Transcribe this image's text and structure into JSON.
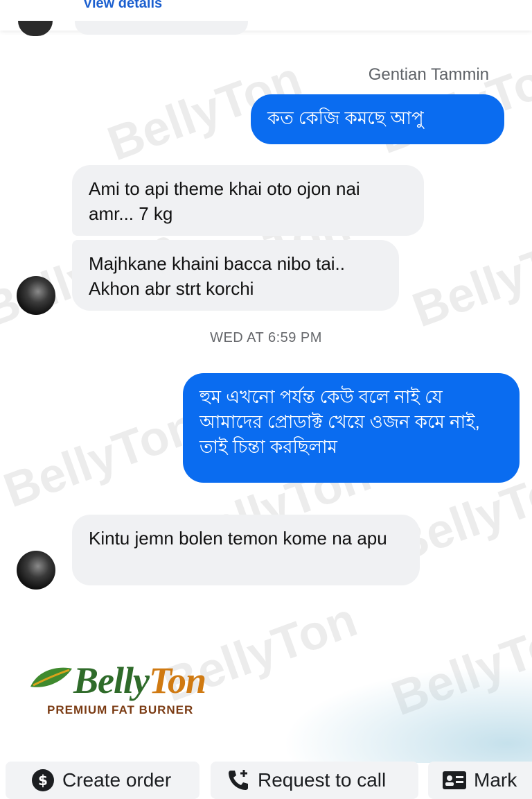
{
  "header": {
    "link_label": "View details"
  },
  "thread": {
    "sender_name": "Gentian Tammin",
    "messages": [
      {
        "id": "m1",
        "direction": "outgoing",
        "text": "কত কেজি কমছে আপু"
      },
      {
        "id": "m2",
        "direction": "incoming",
        "text": "Ami to api theme khai oto ojon nai amr... 7 kg"
      },
      {
        "id": "m3",
        "direction": "incoming",
        "text": "Majhkane khaini bacca nibo tai.. Akhon abr strt korchi"
      },
      {
        "id": "m4",
        "direction": "outgoing",
        "text": "হুম এখনো পর্যন্ত কেউ বলে নাই যে আমাদের প্রোডাক্ট খেয়ে ওজন কমে নাই, তাই চিন্তা করছিলাম"
      },
      {
        "id": "m5",
        "direction": "incoming",
        "text": "Kintu jemn bolen temon kome na apu"
      }
    ],
    "timestamp": "WED AT 6:59 PM"
  },
  "brand": {
    "name_part1": "Belly",
    "name_part2": "Ton",
    "tagline": "PREMIUM FAT BURNER",
    "watermark_text": "BellyTon",
    "colors": {
      "green": "#2f6b2a",
      "orange": "#d07a12",
      "tagline": "#7a3a12"
    }
  },
  "actions": [
    {
      "label": "Create order",
      "icon": "dollar-circle-icon"
    },
    {
      "label": "Request to call",
      "icon": "phone-plus-icon"
    },
    {
      "label": "Mark",
      "icon": "id-card-icon"
    }
  ],
  "colors": {
    "outgoing_bubble": "#0a6cf0",
    "incoming_bubble": "#f0f1f3",
    "link": "#1b5fcf"
  }
}
